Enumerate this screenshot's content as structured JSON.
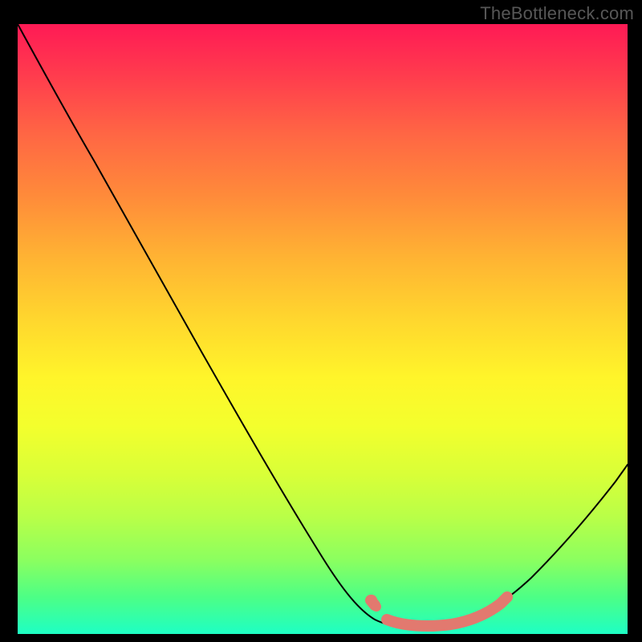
{
  "watermark": "TheBottleneck.com",
  "chart_data": {
    "type": "line",
    "title": "",
    "xlabel": "",
    "ylabel": "",
    "xlim": [
      0,
      100
    ],
    "ylim": [
      0,
      100
    ],
    "grid": false,
    "legend": false,
    "series": [
      {
        "name": "curve",
        "color": "#000000",
        "x": [
          0,
          5,
          10,
          15,
          20,
          25,
          30,
          35,
          40,
          45,
          50,
          55,
          58,
          60,
          63,
          66,
          70,
          74,
          78,
          82,
          86,
          90,
          94,
          98,
          100
        ],
        "y": [
          100,
          94,
          87,
          80,
          73,
          65,
          57,
          49,
          41,
          33,
          25,
          16,
          10,
          6,
          3,
          1.5,
          1,
          1.2,
          2,
          4,
          7.5,
          12,
          18,
          25,
          29
        ]
      },
      {
        "name": "highlight-band",
        "color": "#e2796f",
        "x": [
          58,
          62,
          66,
          70,
          74,
          78,
          80
        ],
        "y": [
          5,
          2,
          1.2,
          1,
          1.2,
          2.5,
          4
        ]
      }
    ],
    "annotations": [
      {
        "name": "highlight-dot-left",
        "x": 58,
        "y": 5,
        "color": "#e2796f"
      }
    ]
  }
}
